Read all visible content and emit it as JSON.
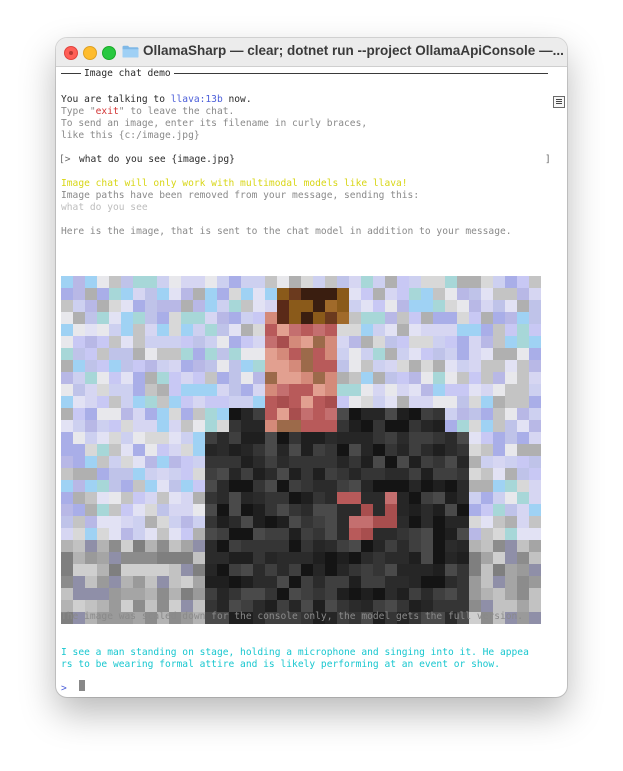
{
  "window": {
    "title": "OllamaSharp — clear; dotnet run --project OllamaApiConsole —..."
  },
  "header": {
    "rule_label": "Image chat demo"
  },
  "intro": {
    "line1_prefix": "You are talking to ",
    "model": "llava:13b",
    "line1_suffix": " now.",
    "line2_prefix": "Type \"",
    "exit_word": "exit",
    "line2_suffix": "\" to leave the chat.",
    "line3": "To send an image, enter its filename in curly braces,",
    "line4": "like this {c:/image.jpg}"
  },
  "prompt": {
    "open_bracket": "[>",
    "input": "what do you see {image.jpg}",
    "close_bracket": "]"
  },
  "notice": {
    "warning": "Image chat will only work with multimodal models like llava!",
    "removed": "Image paths have been removed from your message, sending this:",
    "sent_text": "what do you see"
  },
  "image_caption": "Here is the image, that is sent to the chat model in addition to your message.",
  "scaled_note": "The image was scaled down for the console only, the model gets the full version.",
  "response": {
    "line1": "I see a man standing on stage, holding a microphone and singing into it. He appea",
    "line2": "rs to be wearing formal attire and is likely performing at an event or show."
  },
  "next_prompt": ">",
  "colors": {
    "model_name": "#4b5ed9",
    "exit_word": "#d23434",
    "warning": "#d8d616",
    "response": "#19c7cf"
  },
  "icons": {
    "folder": "folder-icon",
    "scroll": "scroll-menu-icon"
  }
}
